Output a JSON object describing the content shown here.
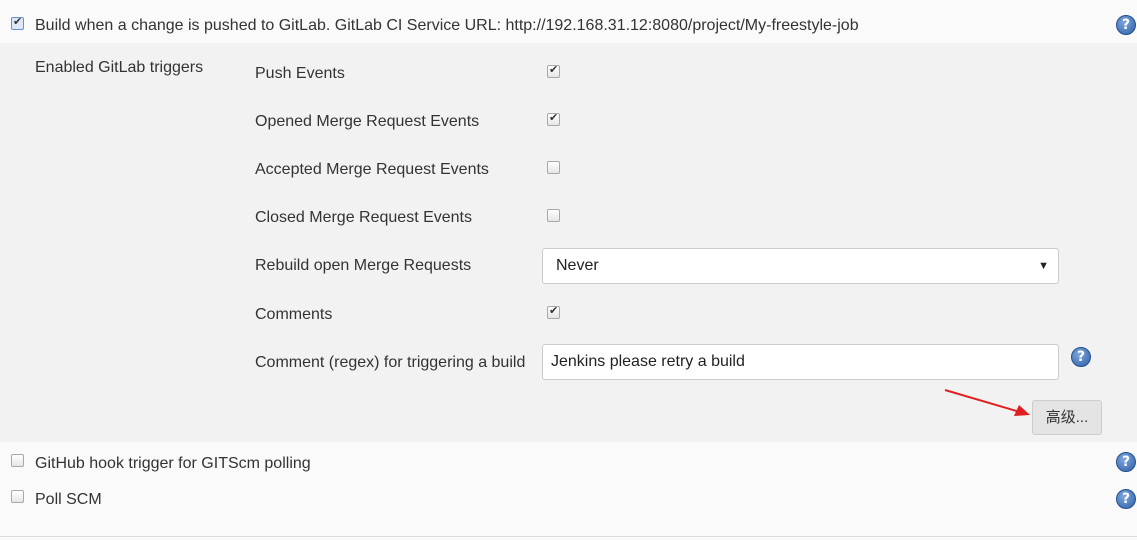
{
  "gitlab_trigger": {
    "label": "Build when a change is pushed to GitLab. GitLab CI Service URL: http://192.168.31.12:8080/project/My-freestyle-job",
    "checked": true
  },
  "triggers_section": {
    "label": "Enabled GitLab triggers",
    "push": {
      "label": "Push Events",
      "checked": true
    },
    "opened_mr": {
      "label": "Opened Merge Request Events",
      "checked": true
    },
    "accepted_mr": {
      "label": "Accepted Merge Request Events",
      "checked": false
    },
    "closed_mr": {
      "label": "Closed Merge Request Events",
      "checked": false
    },
    "rebuild": {
      "label": "Rebuild open Merge Requests",
      "value": "Never"
    },
    "comments": {
      "label": "Comments",
      "checked": true
    },
    "comment_regex": {
      "label": "Comment (regex) for triggering a build",
      "value": "Jenkins please retry a build"
    },
    "advanced_button": "高级..."
  },
  "github_trigger": {
    "label": "GitHub hook trigger for GITScm polling",
    "checked": false
  },
  "poll_scm": {
    "label": "Poll SCM",
    "checked": false
  },
  "help_icon": "?",
  "annotation": {
    "arrow_color": "#e02020"
  }
}
